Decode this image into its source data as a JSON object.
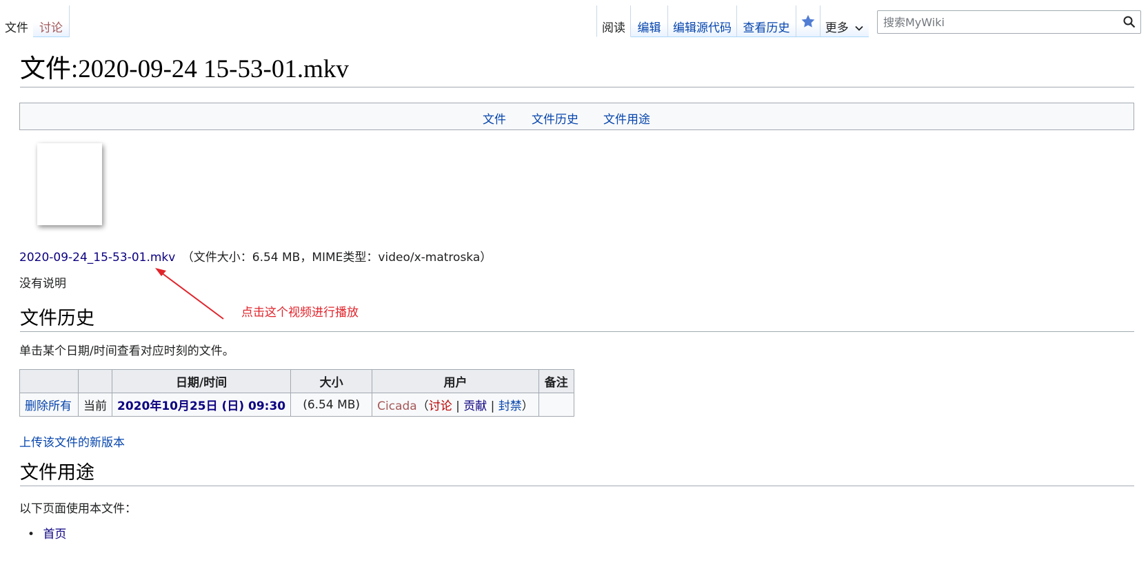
{
  "tabs_left": [
    {
      "label": "文件"
    },
    {
      "label": "讨论"
    }
  ],
  "tabs_right": [
    {
      "label": "阅读"
    },
    {
      "label": "编辑"
    },
    {
      "label": "编辑源代码"
    },
    {
      "label": "查看历史"
    },
    {
      "label": "更多"
    }
  ],
  "search": {
    "placeholder": "搜索MyWiki"
  },
  "page_title": "文件:2020-09-24 15-53-01.mkv",
  "file_toc": [
    {
      "label": "文件"
    },
    {
      "label": "文件历史"
    },
    {
      "label": "文件用途"
    }
  ],
  "file_info": {
    "filename": "2020-09-24_15-53-01.mkv",
    "details": "（文件大小：6.54 MB，MIME类型：video/x-matroska）"
  },
  "no_description": "没有说明",
  "annotation": {
    "text": "点击这个视频进行播放",
    "color": "#e0242b"
  },
  "history_section": {
    "heading": "文件历史",
    "intro": "单击某个日期/时间查看对应时刻的文件。",
    "columns": [
      "",
      "",
      "日期/时间",
      "大小",
      "用户",
      "备注"
    ],
    "row": {
      "action": "删除所有",
      "status": "当前",
      "datetime": "2020年10月25日 (日) 09:30",
      "size": "(6.54 MB)",
      "user": "Cicada",
      "user_open_paren": "（",
      "talk": "讨论",
      "sep1": " | ",
      "contribs": "贡献",
      "sep2": " | ",
      "block": "封禁",
      "user_close_paren": "）",
      "comment": ""
    }
  },
  "upload_new_version": "上传该文件的新版本",
  "usage_section": {
    "heading": "文件用途",
    "intro": "以下页面使用本文件：",
    "pages": [
      "首页"
    ]
  },
  "colors": {
    "link": "#0645ad",
    "visited_link": "#0b0080",
    "redlink": "#ba0000",
    "annotation": "#e0242b"
  }
}
